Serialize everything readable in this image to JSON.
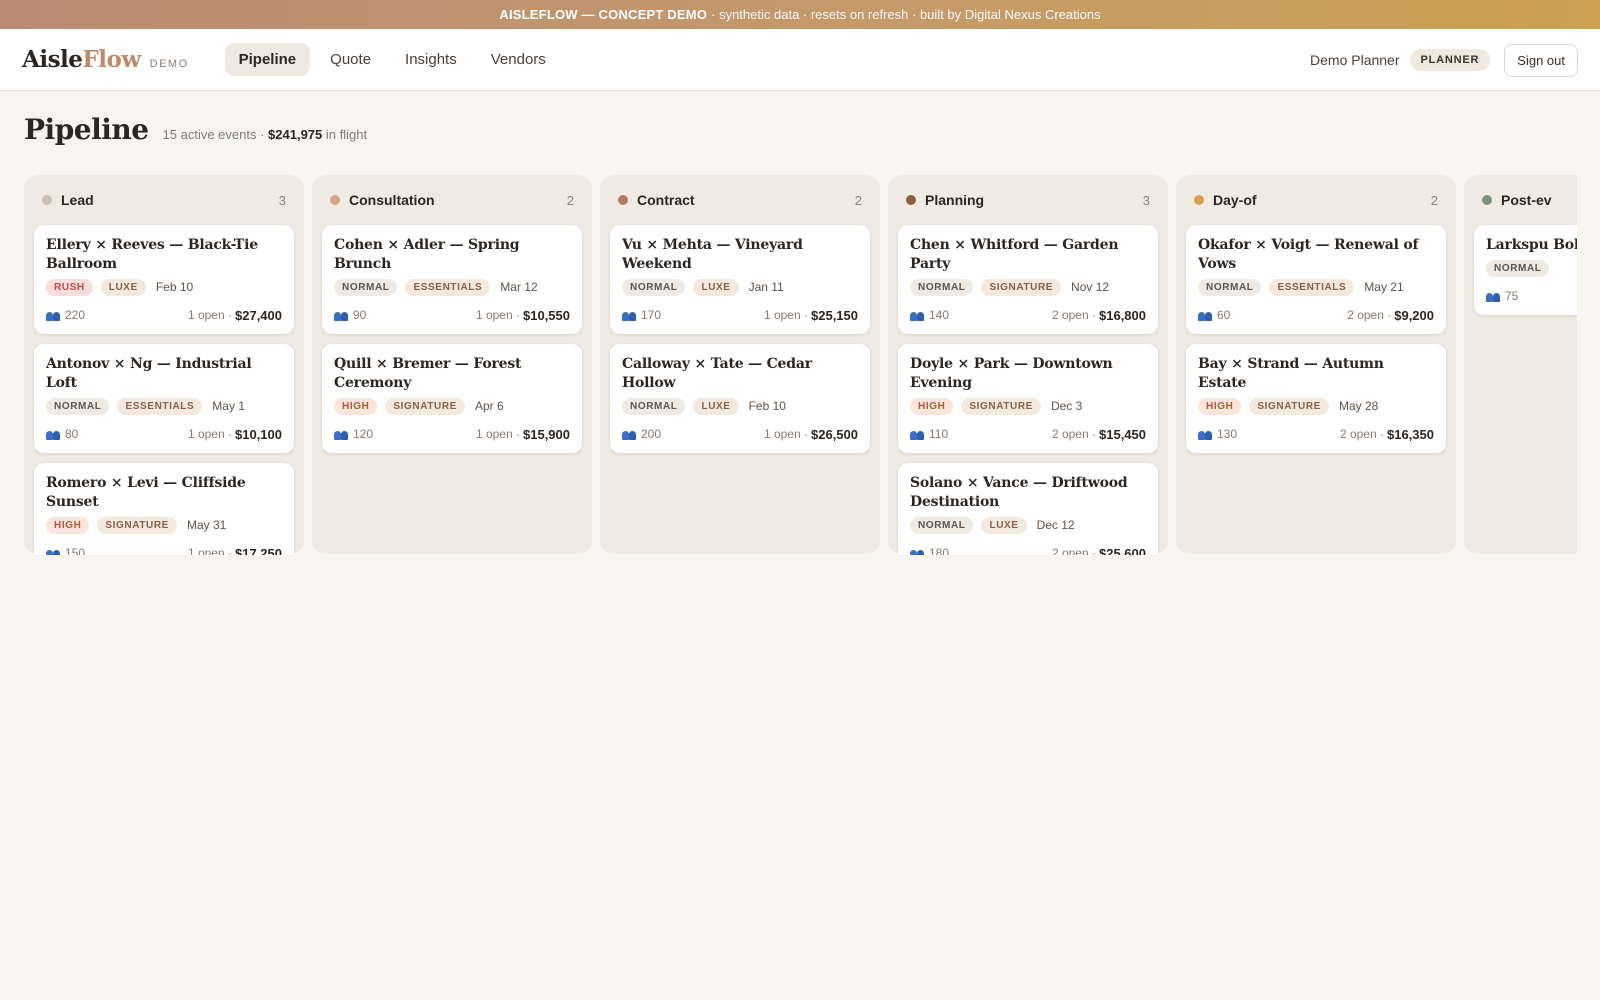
{
  "banner": {
    "strong": "AISLEFLOW — CONCEPT DEMO",
    "rest": "· synthetic data · resets on refresh · built by Digital Nexus Creations"
  },
  "brand": {
    "part1": "Aisle",
    "part2": "Flow",
    "tag": "DEMO"
  },
  "nav": [
    {
      "label": "Pipeline",
      "active": true
    },
    {
      "label": "Quote",
      "active": false
    },
    {
      "label": "Insights",
      "active": false
    },
    {
      "label": "Vendors",
      "active": false
    }
  ],
  "user": {
    "name": "Demo Planner",
    "role": "PLANNER",
    "signout": "Sign out"
  },
  "page": {
    "title": "Pipeline",
    "active_events": "15 active events ·",
    "total": "$241,975",
    "total_suffix": "in flight"
  },
  "columns": [
    {
      "name": "Lead",
      "count": "3",
      "color": "#cdbfb0",
      "cards": [
        {
          "title": "Ellery × Reeves — Black-Tie Ballroom",
          "priority": "RUSH",
          "tier": "LUXE",
          "date": "Feb 10",
          "guests": "220",
          "open": "1 open ·",
          "amount": "$27,400"
        },
        {
          "title": "Antonov × Ng — Industrial Loft",
          "priority": "NORMAL",
          "tier": "ESSENTIALS",
          "date": "May 1",
          "guests": "80",
          "open": "1 open ·",
          "amount": "$10,100"
        },
        {
          "title": "Romero × Levi — Cliffside Sunset",
          "priority": "HIGH",
          "tier": "SIGNATURE",
          "date": "May 31",
          "guests": "150",
          "open": "1 open ·",
          "amount": "$17,250"
        }
      ]
    },
    {
      "name": "Consultation",
      "count": "2",
      "color": "#d4a888",
      "cards": [
        {
          "title": "Cohen × Adler — Spring Brunch",
          "priority": "NORMAL",
          "tier": "ESSENTIALS",
          "date": "Mar 12",
          "guests": "90",
          "open": "1 open ·",
          "amount": "$10,550"
        },
        {
          "title": "Quill × Bremer — Forest Ceremony",
          "priority": "HIGH",
          "tier": "SIGNATURE",
          "date": "Apr 6",
          "guests": "120",
          "open": "1 open ·",
          "amount": "$15,900"
        }
      ]
    },
    {
      "name": "Contract",
      "count": "2",
      "color": "#b57a62",
      "cards": [
        {
          "title": "Vu × Mehta — Vineyard Weekend",
          "priority": "NORMAL",
          "tier": "LUXE",
          "date": "Jan 11",
          "guests": "170",
          "open": "1 open ·",
          "amount": "$25,150"
        },
        {
          "title": "Calloway × Tate — Cedar Hollow",
          "priority": "NORMAL",
          "tier": "LUXE",
          "date": "Feb 10",
          "guests": "200",
          "open": "1 open ·",
          "amount": "$26,500"
        }
      ]
    },
    {
      "name": "Planning",
      "count": "3",
      "color": "#8a5e48",
      "cards": [
        {
          "title": "Chen × Whitford — Garden Party",
          "priority": "NORMAL",
          "tier": "SIGNATURE",
          "date": "Nov 12",
          "guests": "140",
          "open": "2 open ·",
          "amount": "$16,800"
        },
        {
          "title": "Doyle × Park — Downtown Evening",
          "priority": "HIGH",
          "tier": "SIGNATURE",
          "date": "Dec 3",
          "guests": "110",
          "open": "2 open ·",
          "amount": "$15,450"
        },
        {
          "title": "Solano × Vance — Driftwood Destination",
          "priority": "NORMAL",
          "tier": "LUXE",
          "date": "Dec 12",
          "guests": "180",
          "open": "2 open ·",
          "amount": "$25,600"
        }
      ]
    },
    {
      "name": "Day-of",
      "count": "2",
      "color": "#d4a04e",
      "cards": [
        {
          "title": "Okafor × Voigt — Renewal of Vows",
          "priority": "NORMAL",
          "tier": "ESSENTIALS",
          "date": "May 21",
          "guests": "60",
          "open": "2 open ·",
          "amount": "$9,200"
        },
        {
          "title": "Bay × Strand — Autumn Estate",
          "priority": "HIGH",
          "tier": "SIGNATURE",
          "date": "May 28",
          "guests": "130",
          "open": "2 open ·",
          "amount": "$16,350"
        }
      ]
    },
    {
      "name": "Post-ev",
      "count": "",
      "color": "#7d9177",
      "cards": [
        {
          "title": "Larkspu Boho",
          "priority": "NORMAL",
          "tier": "",
          "date": "",
          "guests": "75",
          "open": "",
          "amount": ""
        }
      ]
    }
  ]
}
